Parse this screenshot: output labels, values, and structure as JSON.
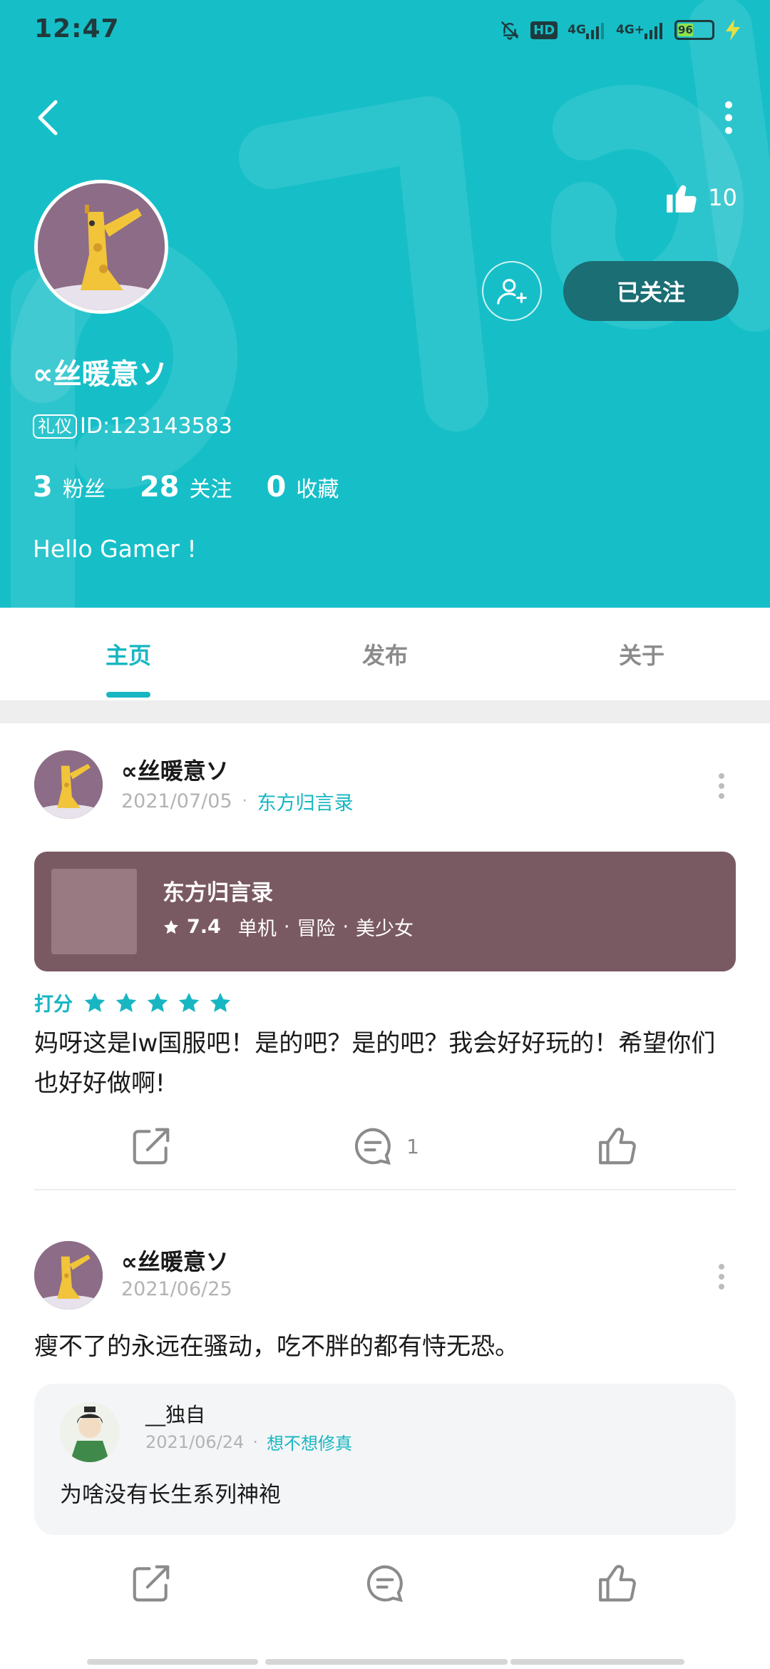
{
  "status_bar": {
    "time": "12:47",
    "hd_label": "HD",
    "net1": "4G",
    "net2": "4G+",
    "battery": "96",
    "colors": {
      "battery_fill": "#8ee34b"
    }
  },
  "header": {
    "back_icon": "chevron-left-icon",
    "more_icon": "more-vertical-icon",
    "like_count": "10",
    "follow_label": "已关注",
    "username": "∝丝暖意ソ",
    "level_badge": "礼仪",
    "user_id": "ID:123143583",
    "stats": [
      {
        "num": "3",
        "label": "粉丝"
      },
      {
        "num": "28",
        "label": "关注"
      },
      {
        "num": "0",
        "label": "收藏"
      }
    ],
    "bio": "Hello Gamer !",
    "colors": {
      "bg": "#16bfc8",
      "follow_bg": "#1a6e74"
    }
  },
  "tabs": [
    {
      "label": "主页",
      "active": true
    },
    {
      "label": "发布",
      "active": false
    },
    {
      "label": "关于",
      "active": false
    }
  ],
  "posts": [
    {
      "author": "∝丝暖意ソ",
      "date": "2021/07/05",
      "tag": "东方归言录",
      "game": {
        "title": "东方归言录",
        "score": "7.4",
        "genres": [
          "单机",
          "冒险",
          "美少女"
        ]
      },
      "rating_label": "打分",
      "rating_stars": 5,
      "text": "妈呀这是lw国服吧！是的吧？是的吧？我会好好玩的！希望你们也好好做啊!",
      "comment_count": "1"
    },
    {
      "author": "∝丝暖意ソ",
      "date": "2021/06/25",
      "text": "瘦不了的永远在骚动，吃不胖的都有恃无恐。",
      "reply": {
        "author": "__独自",
        "date": "2021/06/24",
        "tag": "想不想修真",
        "text": "为啥没有长生系列神袍"
      }
    }
  ],
  "accent_color": "#17b6c2"
}
